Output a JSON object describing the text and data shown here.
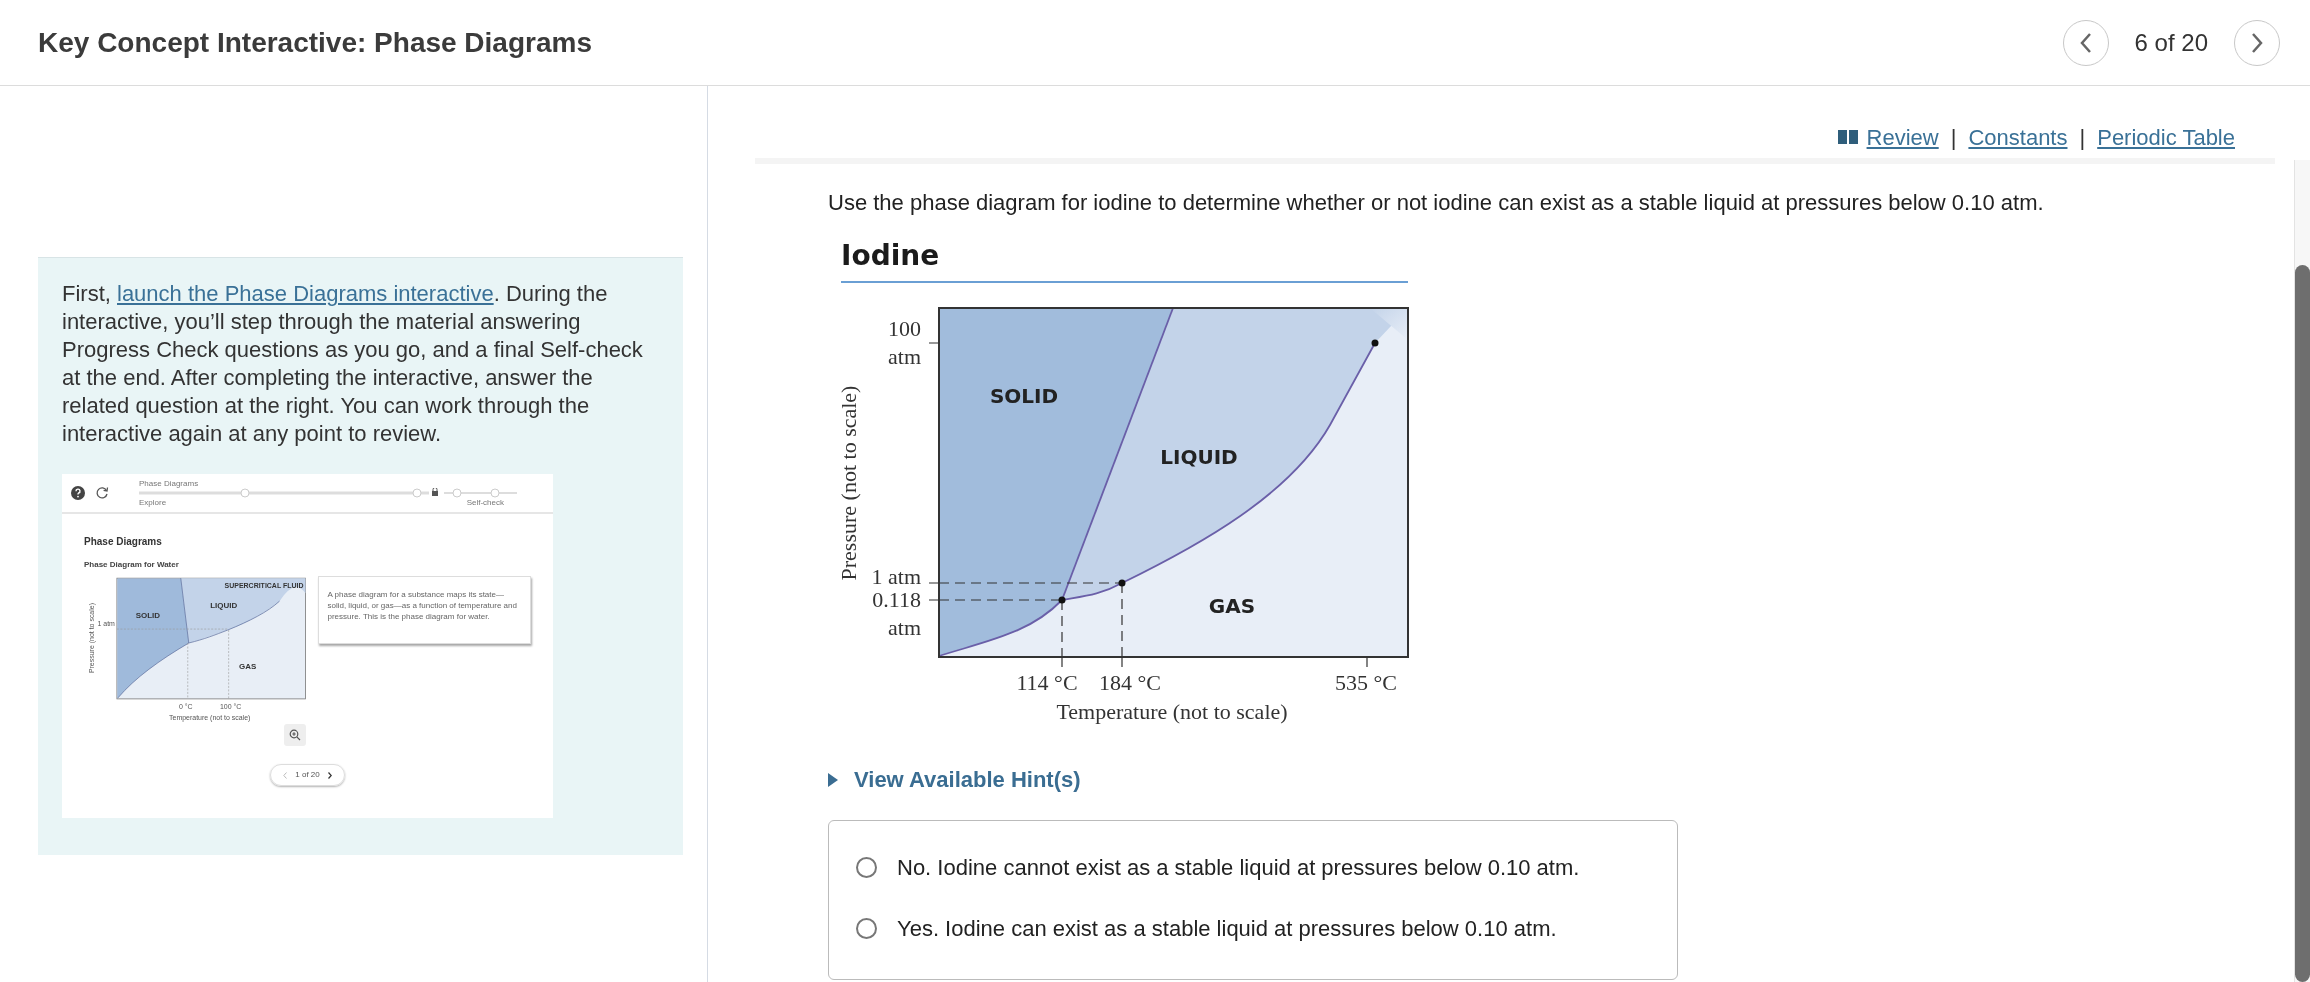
{
  "header": {
    "title": "Key Concept Interactive: Phase Diagrams",
    "position": "6 of 20"
  },
  "intro": {
    "before": "First, ",
    "link": "launch the Phase Diagrams interactive",
    "after": ". During the interactive, you’ll step through the material answering Progress Check questions as you go, and a final Self-check at the end. After completing the interactive, answer the related question at the right. You can work through the interactive again at any point to review."
  },
  "preview": {
    "module": "Phase Diagrams",
    "step_start": "Explore",
    "step_end": "Self-check",
    "heading": "Phase Diagrams",
    "subheading": "Phase Diagram for Water",
    "description": "A phase diagram for a substance maps its state—solid, liquid, or gas—as a function of temperature and pressure. This is the phase diagram for water.",
    "regions": [
      "SUPERCRITICAL FLUID",
      "LIQUID",
      "SOLID",
      "GAS"
    ],
    "ylabel": "Pressure (not to scale)",
    "ytick": "1 atm",
    "xticks": [
      "0 °C",
      "100 °C"
    ],
    "xlabel": "Temperature (not to scale)",
    "page": "1 of 20"
  },
  "resources": {
    "links": [
      "Review",
      "Constants",
      "Periodic Table"
    ],
    "separator": "|"
  },
  "question": "Use the phase diagram for iodine to determine whether or not iodine can exist as a stable liquid at pressures below 0.10 atm.",
  "figure": {
    "title": "Iodine",
    "regions": [
      "SOLID",
      "LIQUID",
      "GAS"
    ],
    "yticks": [
      "100",
      "atm",
      "1 atm",
      "0.118",
      "atm"
    ],
    "xticks": [
      "114 °C",
      "184 °C",
      "535 °C"
    ],
    "xlabel": "Temperature (not to scale)",
    "ylabel": "Pressure (not to scale)"
  },
  "hint": {
    "label": "View Available Hint(s)",
    "expanded": false
  },
  "choices": [
    {
      "text": "No. Iodine cannot exist as a stable liquid at pressures below 0.10 atm.",
      "selected": false
    },
    {
      "text": "Yes. Iodine can exist as a stable liquid at pressures below 0.10 atm.",
      "selected": false
    }
  ]
}
